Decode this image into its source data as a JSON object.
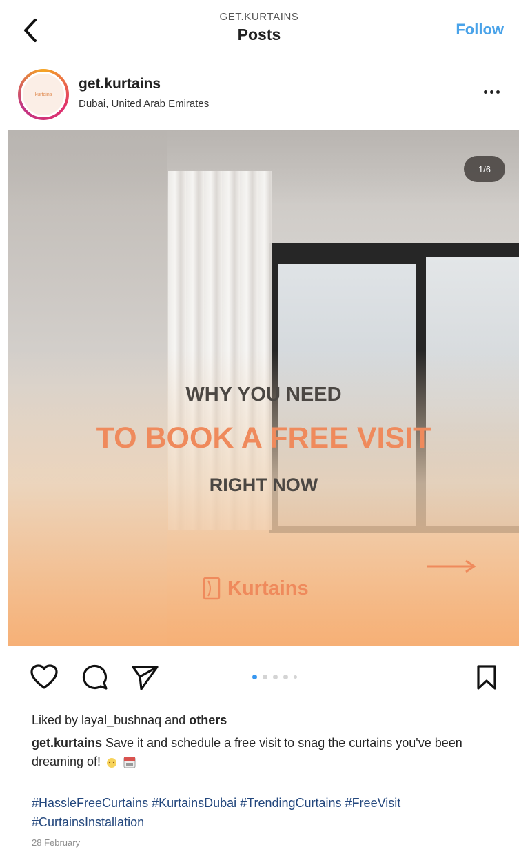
{
  "header": {
    "subtitle": "GET.KURTAINS",
    "title": "Posts",
    "follow_label": "Follow"
  },
  "post": {
    "username": "get.kurtains",
    "location": "Dubai, United Arab Emirates",
    "avatar_text": "kurtains",
    "slide_counter": "1/6",
    "image_text": {
      "line1": "WHY YOU NEED",
      "line2": "TO BOOK A FREE VISIT",
      "line3": "RIGHT NOW",
      "brand": "Kurtains"
    },
    "carousel": {
      "total": 5,
      "active_index": 0
    },
    "likes": {
      "prefix": "Liked by ",
      "user": "layal_bushnaq",
      "middle": " and ",
      "suffix": "others"
    },
    "caption": {
      "user": "get.kurtains",
      "text": " Save it and schedule a free visit to snag the curtains you've been dreaming of!"
    },
    "hashtags": "#HassleFreeCurtains #KurtainsDubai #TrendingCurtains #FreeVisit #CurtainsInstallation",
    "date": "28 February"
  },
  "icons": {
    "back": "chevron-left-icon",
    "more": "more-horizontal-icon",
    "like": "heart-icon",
    "comment": "comment-icon",
    "share": "send-icon",
    "save": "bookmark-icon"
  },
  "colors": {
    "follow": "#4aa3e9",
    "accent_orange": "#ef8a5c",
    "dot_active": "#3897f0",
    "hashtag": "#23477d"
  }
}
